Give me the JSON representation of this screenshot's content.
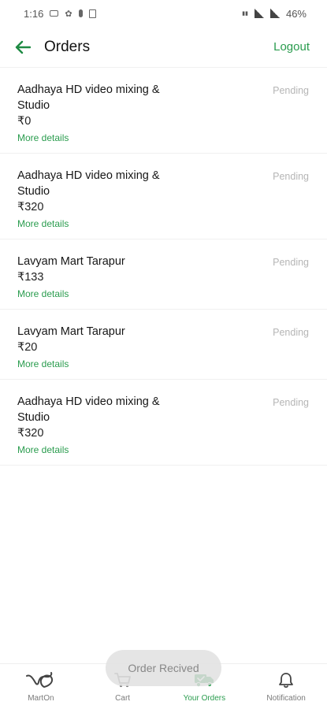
{
  "status_bar": {
    "time": "1:16",
    "battery": "46%"
  },
  "header": {
    "title": "Orders",
    "logout_label": "Logout"
  },
  "orders": [
    {
      "name": "Aadhaya HD video mixing & Studio",
      "price": "₹0",
      "status": "Pending",
      "more_label": "More details"
    },
    {
      "name": "Aadhaya HD video mixing & Studio",
      "price": "₹320",
      "status": "Pending",
      "more_label": "More details"
    },
    {
      "name": "Lavyam Mart Tarapur",
      "price": "₹133",
      "status": "Pending",
      "more_label": "More details"
    },
    {
      "name": "Lavyam Mart Tarapur",
      "price": "₹20",
      "status": "Pending",
      "more_label": "More details"
    },
    {
      "name": "Aadhaya HD video mixing & Studio",
      "price": "₹320",
      "status": "Pending",
      "more_label": "More details"
    }
  ],
  "toast": {
    "message": "Order Recived"
  },
  "bottom_nav": {
    "items": [
      {
        "label": "MartOn",
        "icon": "marton-logo-icon",
        "active": false
      },
      {
        "label": "Cart",
        "icon": "cart-icon",
        "active": false
      },
      {
        "label": "Your Orders",
        "icon": "delivery-truck-icon",
        "active": true
      },
      {
        "label": "Notification",
        "icon": "bell-icon",
        "active": false
      }
    ]
  },
  "colors": {
    "accent": "#2a9c4e",
    "status_pending": "#b5b5b5"
  }
}
